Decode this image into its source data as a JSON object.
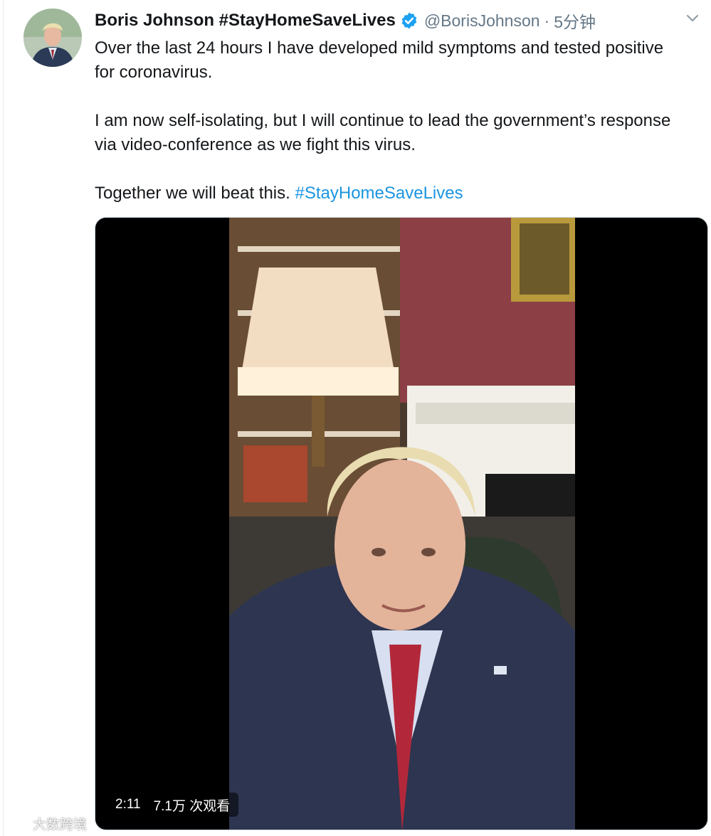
{
  "tweet": {
    "display_name": "Boris Johnson #StayHomeSaveLives",
    "handle": "@BorisJohnson",
    "separator": "·",
    "time": "5分钟",
    "paragraphs": [
      "Over the last 24 hours I have developed mild symptoms and tested positive for coronavirus.",
      "I am now self-isolating, but I will continue to lead the government’s response via video-conference as we fight this virus."
    ],
    "closing_text": "Together we will beat this.",
    "hashtag": "#StayHomeSaveLives",
    "icons": {
      "verified": "verified-badge-icon",
      "caret": "chevron-down-icon"
    },
    "colors": {
      "link": "#1b95e0",
      "verified": "#1da1f2",
      "muted": "#657786"
    }
  },
  "video": {
    "duration": "2:11",
    "views": "7.1万 次观看"
  },
  "watermark": {
    "text": "大数跨境"
  }
}
